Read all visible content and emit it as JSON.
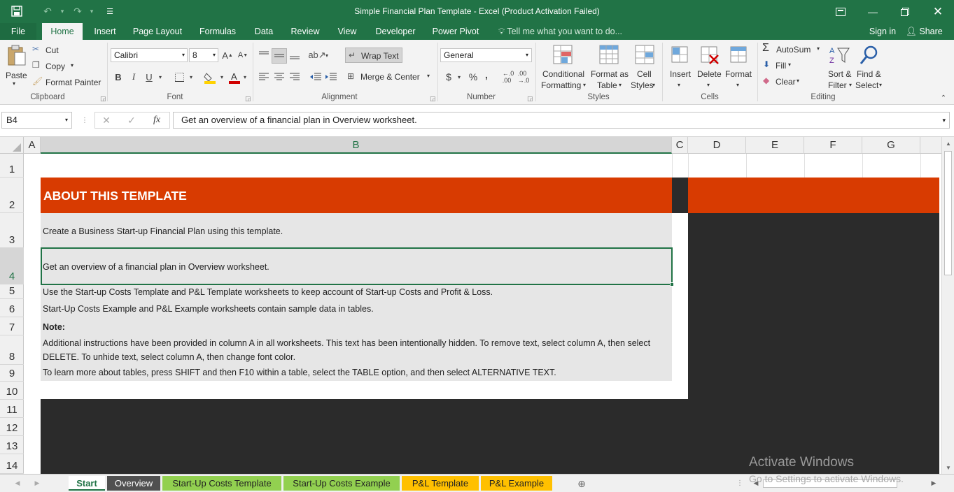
{
  "window": {
    "title": "Simple Financial Plan Template - Excel (Product Activation Failed)"
  },
  "ribbon_tabs": [
    "File",
    "Home",
    "Insert",
    "Page Layout",
    "Formulas",
    "Data",
    "Review",
    "View",
    "Developer",
    "Power Pivot"
  ],
  "active_tab": "Home",
  "tell_me": "Tell me what you want to do...",
  "account": {
    "sign_in": "Sign in",
    "share": "Share"
  },
  "clipboard": {
    "paste": "Paste",
    "cut": "Cut",
    "copy": "Copy",
    "format_painter": "Format Painter",
    "label": "Clipboard"
  },
  "font": {
    "name": "Calibri",
    "size": "8",
    "bold": "B",
    "italic": "I",
    "underline": "U",
    "label": "Font",
    "highlight_color": "#ffd200",
    "font_color": "#d00000"
  },
  "alignment": {
    "wrap_text": "Wrap Text",
    "merge_center": "Merge & Center",
    "label": "Alignment"
  },
  "number": {
    "format": "General",
    "currency": "$",
    "percent": "%",
    "comma": ",",
    "label": "Number"
  },
  "styles": {
    "conditional_1": "Conditional",
    "conditional_2": "Formatting",
    "table_1": "Format as",
    "table_2": "Table",
    "cell_1": "Cell",
    "cell_2": "Styles",
    "label": "Styles"
  },
  "cells": {
    "insert": "Insert",
    "delete": "Delete",
    "format": "Format",
    "label": "Cells"
  },
  "editing": {
    "autosum": "AutoSum",
    "fill": "Fill",
    "clear": "Clear",
    "sort_1": "Sort &",
    "sort_2": "Filter",
    "find_1": "Find &",
    "find_2": "Select",
    "label": "Editing"
  },
  "formula_bar": {
    "name_box": "B4",
    "fx": "fx",
    "content": "Get an overview of a financial plan in Overview worksheet."
  },
  "columns": [
    "A",
    "B",
    "C",
    "D",
    "E",
    "F",
    "G"
  ],
  "rows": [
    "1",
    "2",
    "3",
    "4",
    "5",
    "6",
    "7",
    "8",
    "9",
    "10",
    "11",
    "12",
    "13",
    "14"
  ],
  "sheet": {
    "header": "ABOUT THIS TEMPLATE",
    "header_color": "#d83b01",
    "line1": "Create a Business Start-up Financial Plan using this template.",
    "line2": "Get an overview of a financial plan in Overview worksheet.",
    "line3": "Use the Start-up Costs Template and P&L Template worksheets to keep account of Start-up Costs and Profit & Loss.",
    "line4": "Start-Up Costs Example and P&L Example worksheets contain sample data in tables.",
    "note": "Note:",
    "line5a": "Additional instructions have been provided in column A in all worksheets. This text has been intentionally hidden. To remove text, select column A, then select",
    "line5b": "DELETE. To unhide text, select column A, then change font color.",
    "line6": "To learn more about tables, press SHIFT and then F10 within a table, select the TABLE option, and then select ALTERNATIVE TEXT."
  },
  "sheet_tabs": [
    {
      "label": "Start",
      "color": "#ffffff",
      "text": "#217346"
    },
    {
      "label": "Overview",
      "color": "#505050",
      "text": "#ffffff"
    },
    {
      "label": "Start-Up Costs Template",
      "color": "#92d050",
      "text": "#222222"
    },
    {
      "label": "Start-Up Costs Example",
      "color": "#92d050",
      "text": "#222222"
    },
    {
      "label": "P&L Template",
      "color": "#ffc000",
      "text": "#222222"
    },
    {
      "label": "P&L Example",
      "color": "#ffc000",
      "text": "#222222"
    }
  ],
  "watermark": {
    "line1": "Activate Windows",
    "line2": "Go to Settings to activate Windows."
  }
}
